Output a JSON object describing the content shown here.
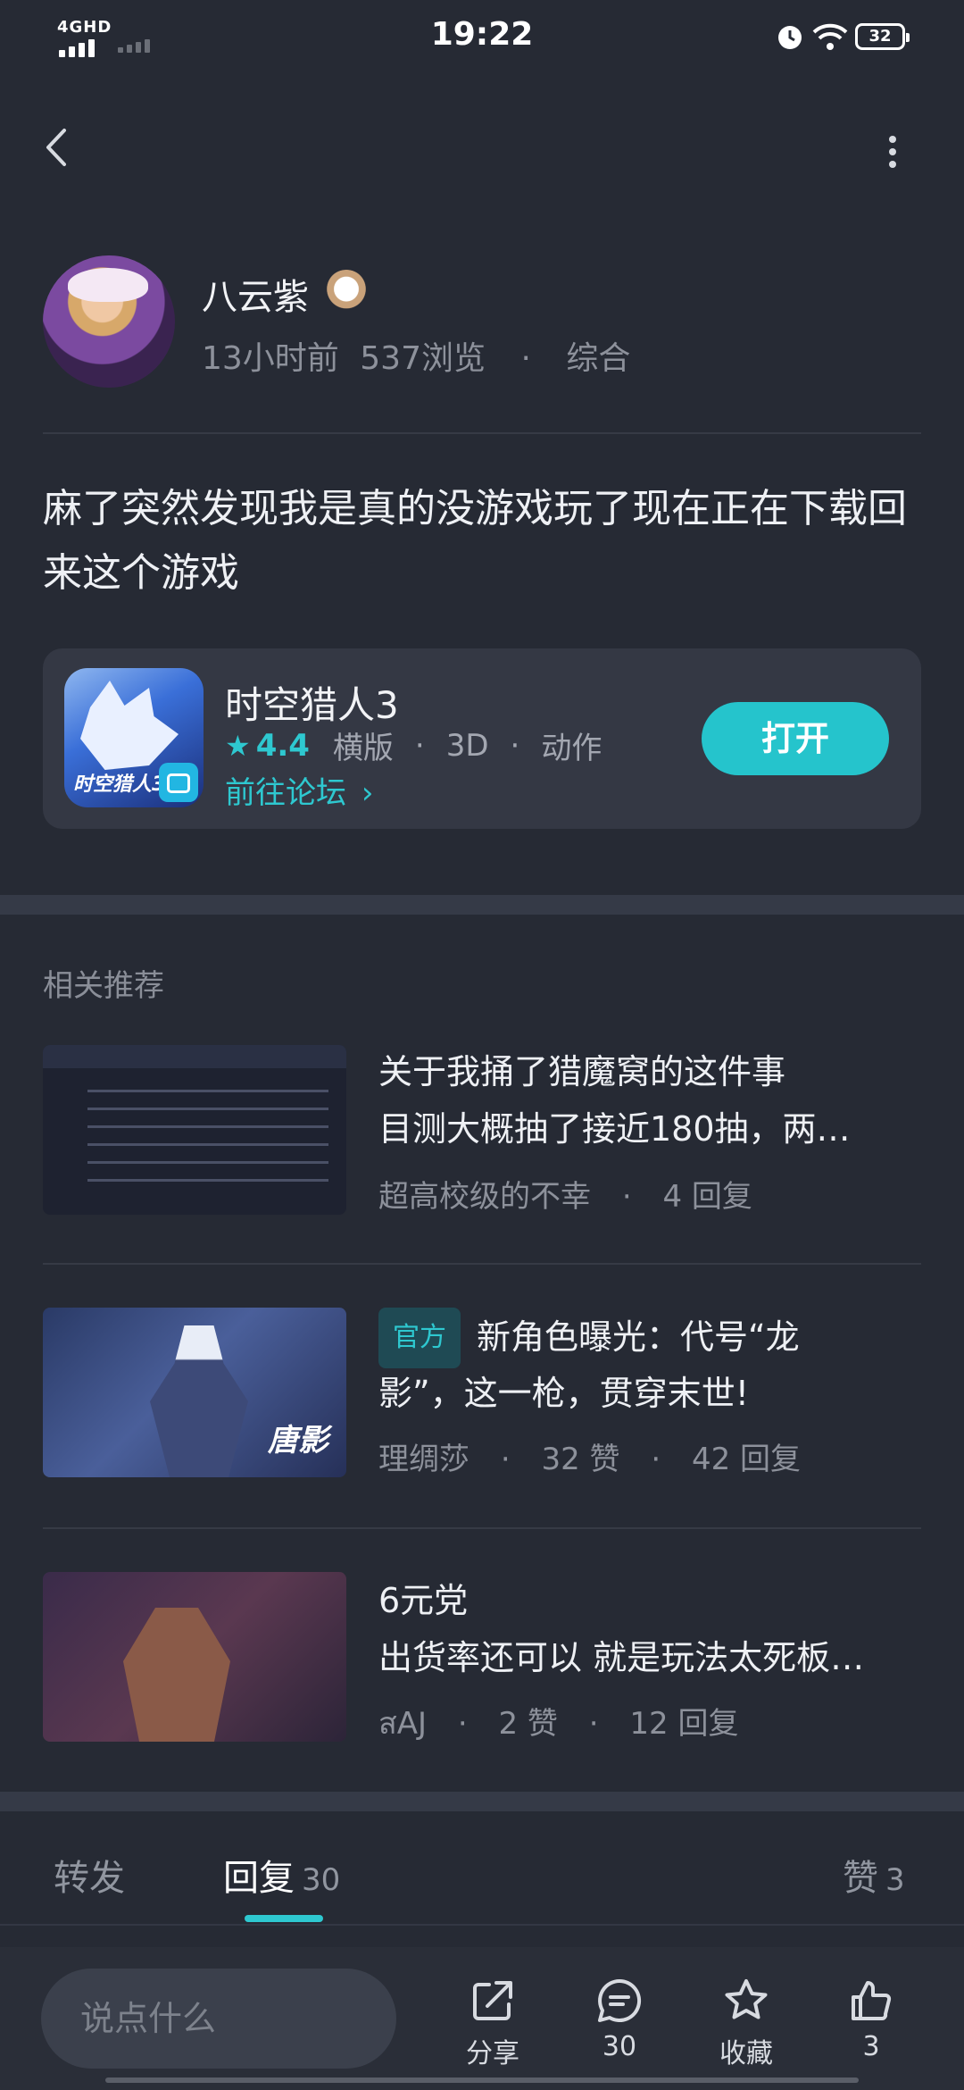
{
  "status": {
    "network": "4GHD",
    "time": "19:22",
    "battery": "32"
  },
  "author": {
    "name": "八云紫",
    "time_ago": "13小时前",
    "views": "537浏览",
    "category": "综合"
  },
  "post": {
    "text": "麻了突然发现我是真的没游戏玩了现在正在下载回来这个游戏"
  },
  "game": {
    "name": "时空猎人3",
    "rating": "4.4",
    "tags": [
      "横版",
      "3D",
      "动作"
    ],
    "forum_link": "前往论坛",
    "open_button": "打开",
    "icon_text": "时空猎人3"
  },
  "related": {
    "title": "相关推荐",
    "items": [
      {
        "title1": "关于我捅了猎魔窝的这件事",
        "title2": "目测大概抽了接近180抽，两…",
        "author": "超高校级的不幸",
        "replies": "4 回复"
      },
      {
        "tag": "官方",
        "title1": "新角色曝光：代号“龙",
        "title2": "影”，这一枪，贯穿末世!",
        "author": "理绸莎",
        "likes": "32 赞",
        "replies": "42 回复",
        "thumb_text": "唐影"
      },
      {
        "title1": "6元党",
        "title2": "出货率还可以 就是玩法太死板…",
        "author": "สAJ",
        "likes": "2 赞",
        "replies": "12 回复"
      }
    ]
  },
  "tabs": {
    "repost": "转发",
    "reply": "回复",
    "reply_count": "30",
    "like": "赞",
    "like_count": "3"
  },
  "bottom": {
    "placeholder": "说点什么",
    "share": "分享",
    "comments": "30",
    "favorite": "收藏",
    "likes": "3"
  },
  "colors": {
    "background": "#262a34",
    "accent": "#2ec8d0",
    "card": "#343844"
  }
}
